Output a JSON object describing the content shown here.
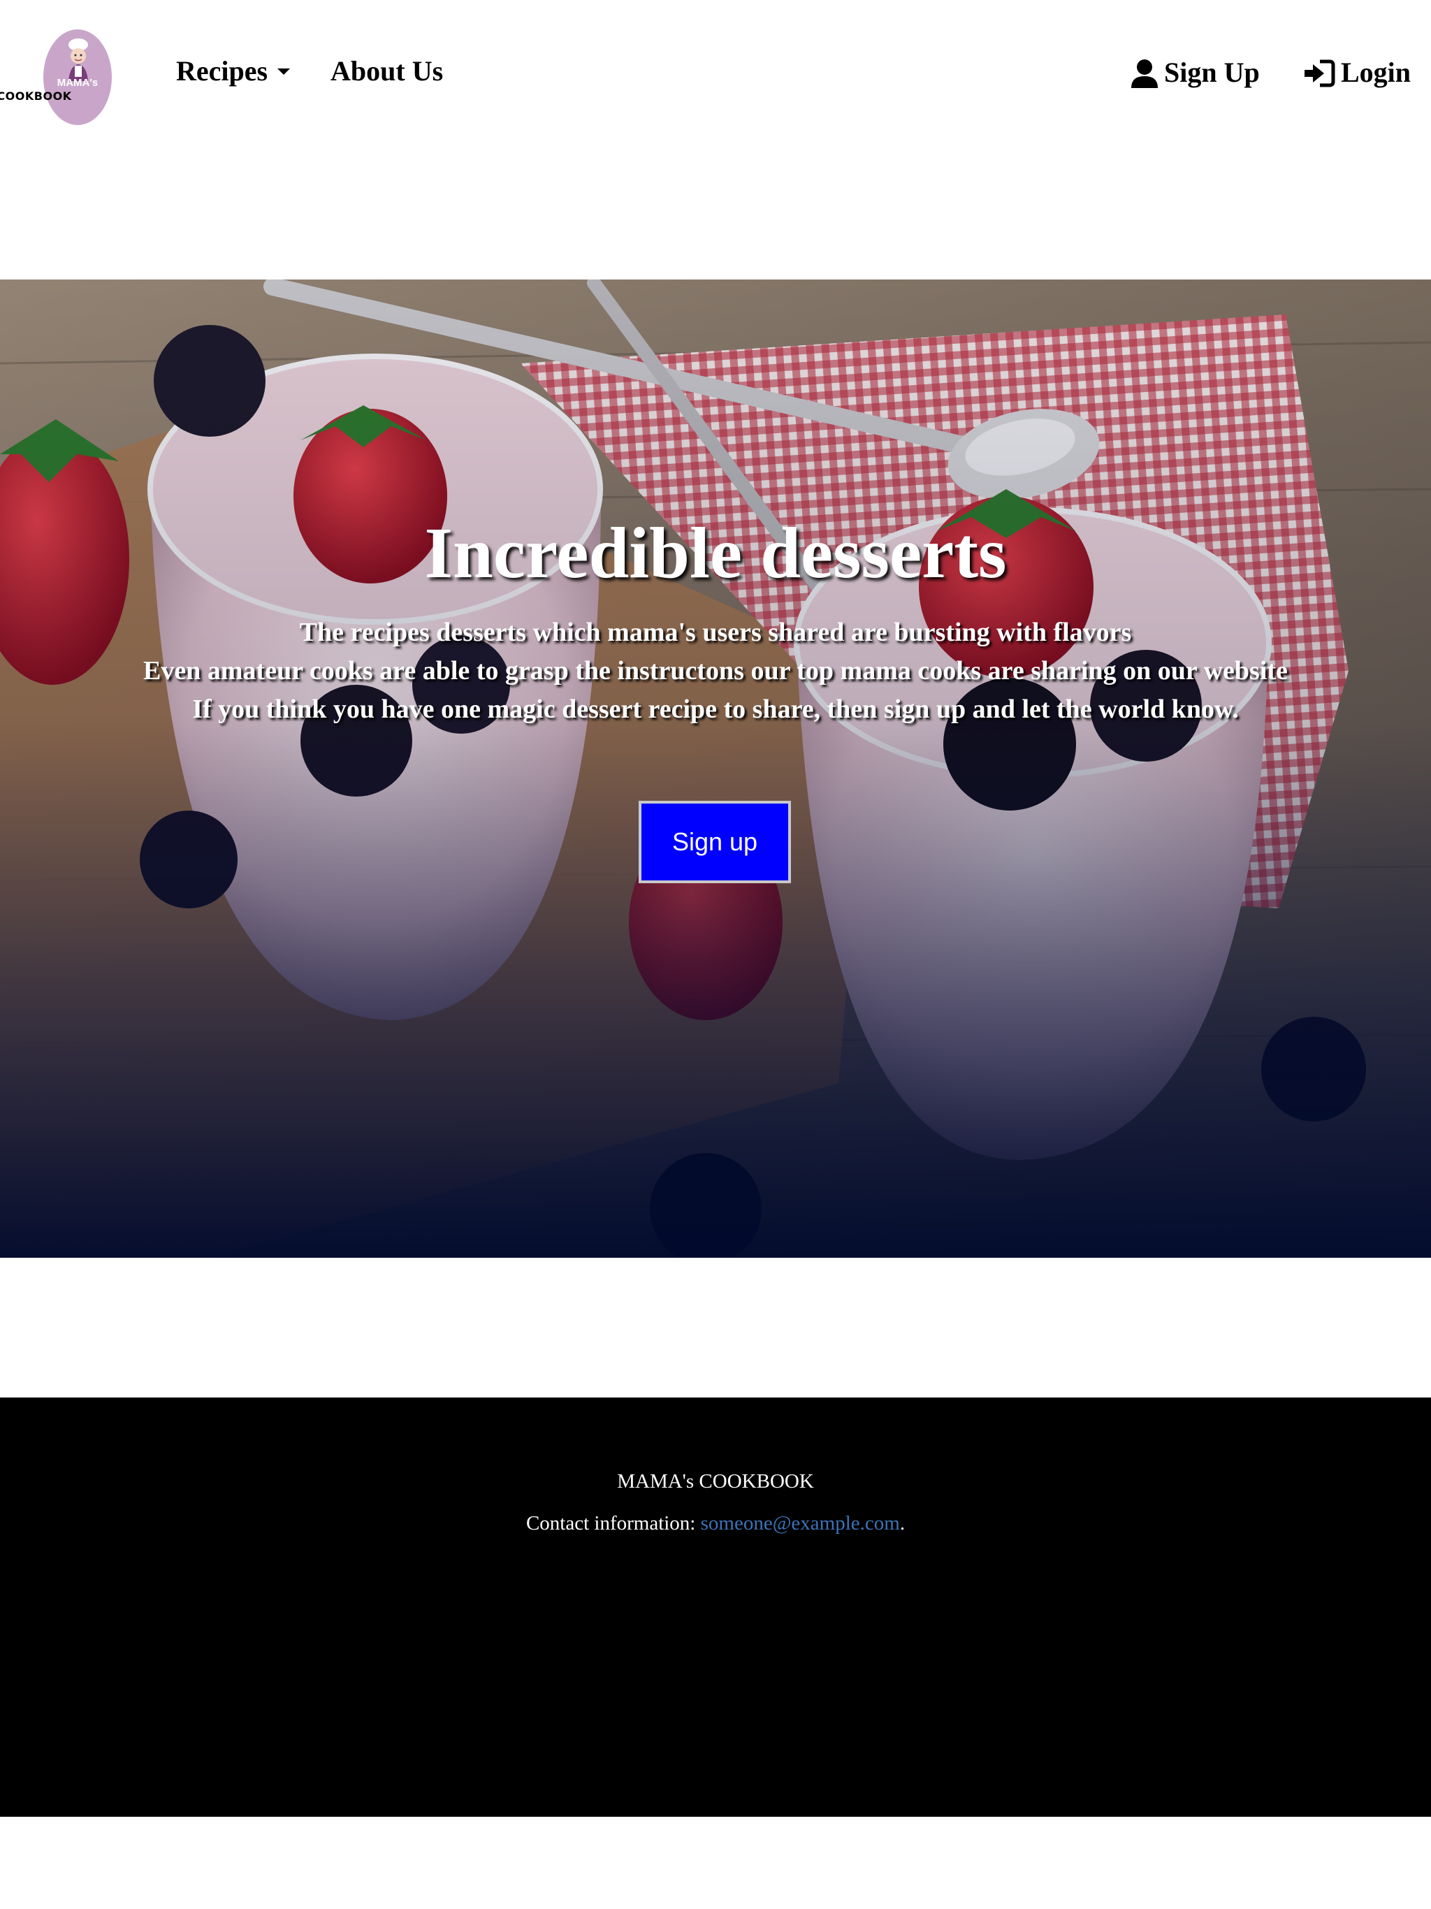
{
  "nav": {
    "logo": {
      "line1": "MAMA's",
      "line2": "COOKBOOK"
    },
    "recipes_label": "Recipes",
    "about_label": "About Us",
    "signup_label": "Sign Up",
    "login_label": "Login"
  },
  "hero": {
    "title": "Incredible desserts",
    "lines": [
      "The recipes desserts which mama's users shared are bursting with flavors",
      "Even amateur cooks are able to grasp the instructons our top mama cooks are sharing on our website",
      "If you think you have one magic dessert recipe to share, then sign up and let the world know."
    ],
    "cta_label": "Sign up",
    "cta_color": "#0000ff"
  },
  "footer": {
    "brand": "MAMA's COOKBOOK",
    "contact_prefix": "Contact information:",
    "email": "someone@example.com",
    "contact_suffix": ".",
    "link_color": "#3b73b9"
  }
}
